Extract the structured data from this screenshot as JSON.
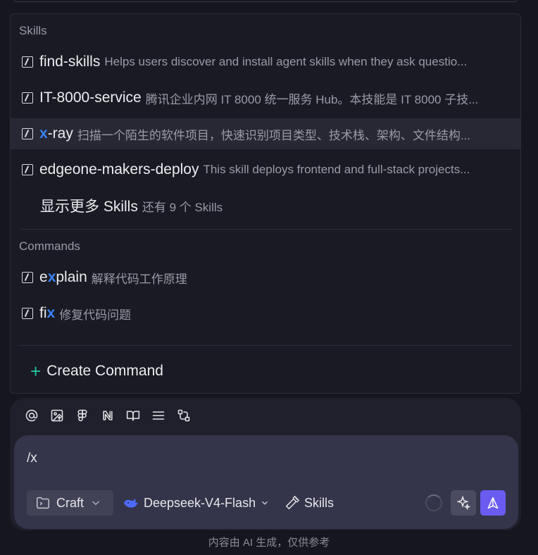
{
  "skills_section": {
    "label": "Skills",
    "items": [
      {
        "prefix": "",
        "match": "",
        "suffix": "find-skills",
        "desc": "Helps users discover and install agent skills when they ask questio..."
      },
      {
        "prefix": "",
        "match": "",
        "suffix": "IT-8000-service",
        "desc": "腾讯企业内网 IT 8000 统一服务 Hub。本技能是 IT 8000 子技..."
      },
      {
        "prefix": "",
        "match": "x",
        "suffix": "-ray",
        "desc": "扫描一个陌生的软件项目，快速识别项目类型、技术栈、架构、文件结构..."
      },
      {
        "prefix": "",
        "match": "",
        "suffix": "edgeone-makers-deploy",
        "desc": "This skill deploys frontend and full-stack projects..."
      }
    ],
    "show_more_label": "显示更多 Skills",
    "show_more_count": "还有 9 个 Skills"
  },
  "commands_section": {
    "label": "Commands",
    "items": [
      {
        "prefix": "e",
        "match": "x",
        "suffix": "plain",
        "desc": "解释代码工作原理"
      },
      {
        "prefix": "fi",
        "match": "x",
        "suffix": "",
        "desc": "修复代码问题"
      }
    ]
  },
  "create_command": {
    "plus": "+",
    "label": "Create Command"
  },
  "composer": {
    "input_value": "/x",
    "mode_label": "Craft",
    "model_label": "Deepseek-V4-Flash",
    "skills_label": "Skills"
  },
  "footer": {
    "note": "内容由 AI 生成，仅供参考"
  },
  "colors": {
    "accent": "#3b82f6",
    "send": "#6a5cf0",
    "plus": "#22c39a"
  },
  "icons": [
    "at-icon",
    "image-upload-icon",
    "figma-icon",
    "notion-icon",
    "book-icon",
    "list-icon",
    "flow-icon",
    "folder-icon",
    "chevron-down-icon",
    "deepseek-whale-icon",
    "hammer-icon",
    "loading-icon",
    "sparkle-icon",
    "send-icon",
    "slash-command-icon"
  ]
}
